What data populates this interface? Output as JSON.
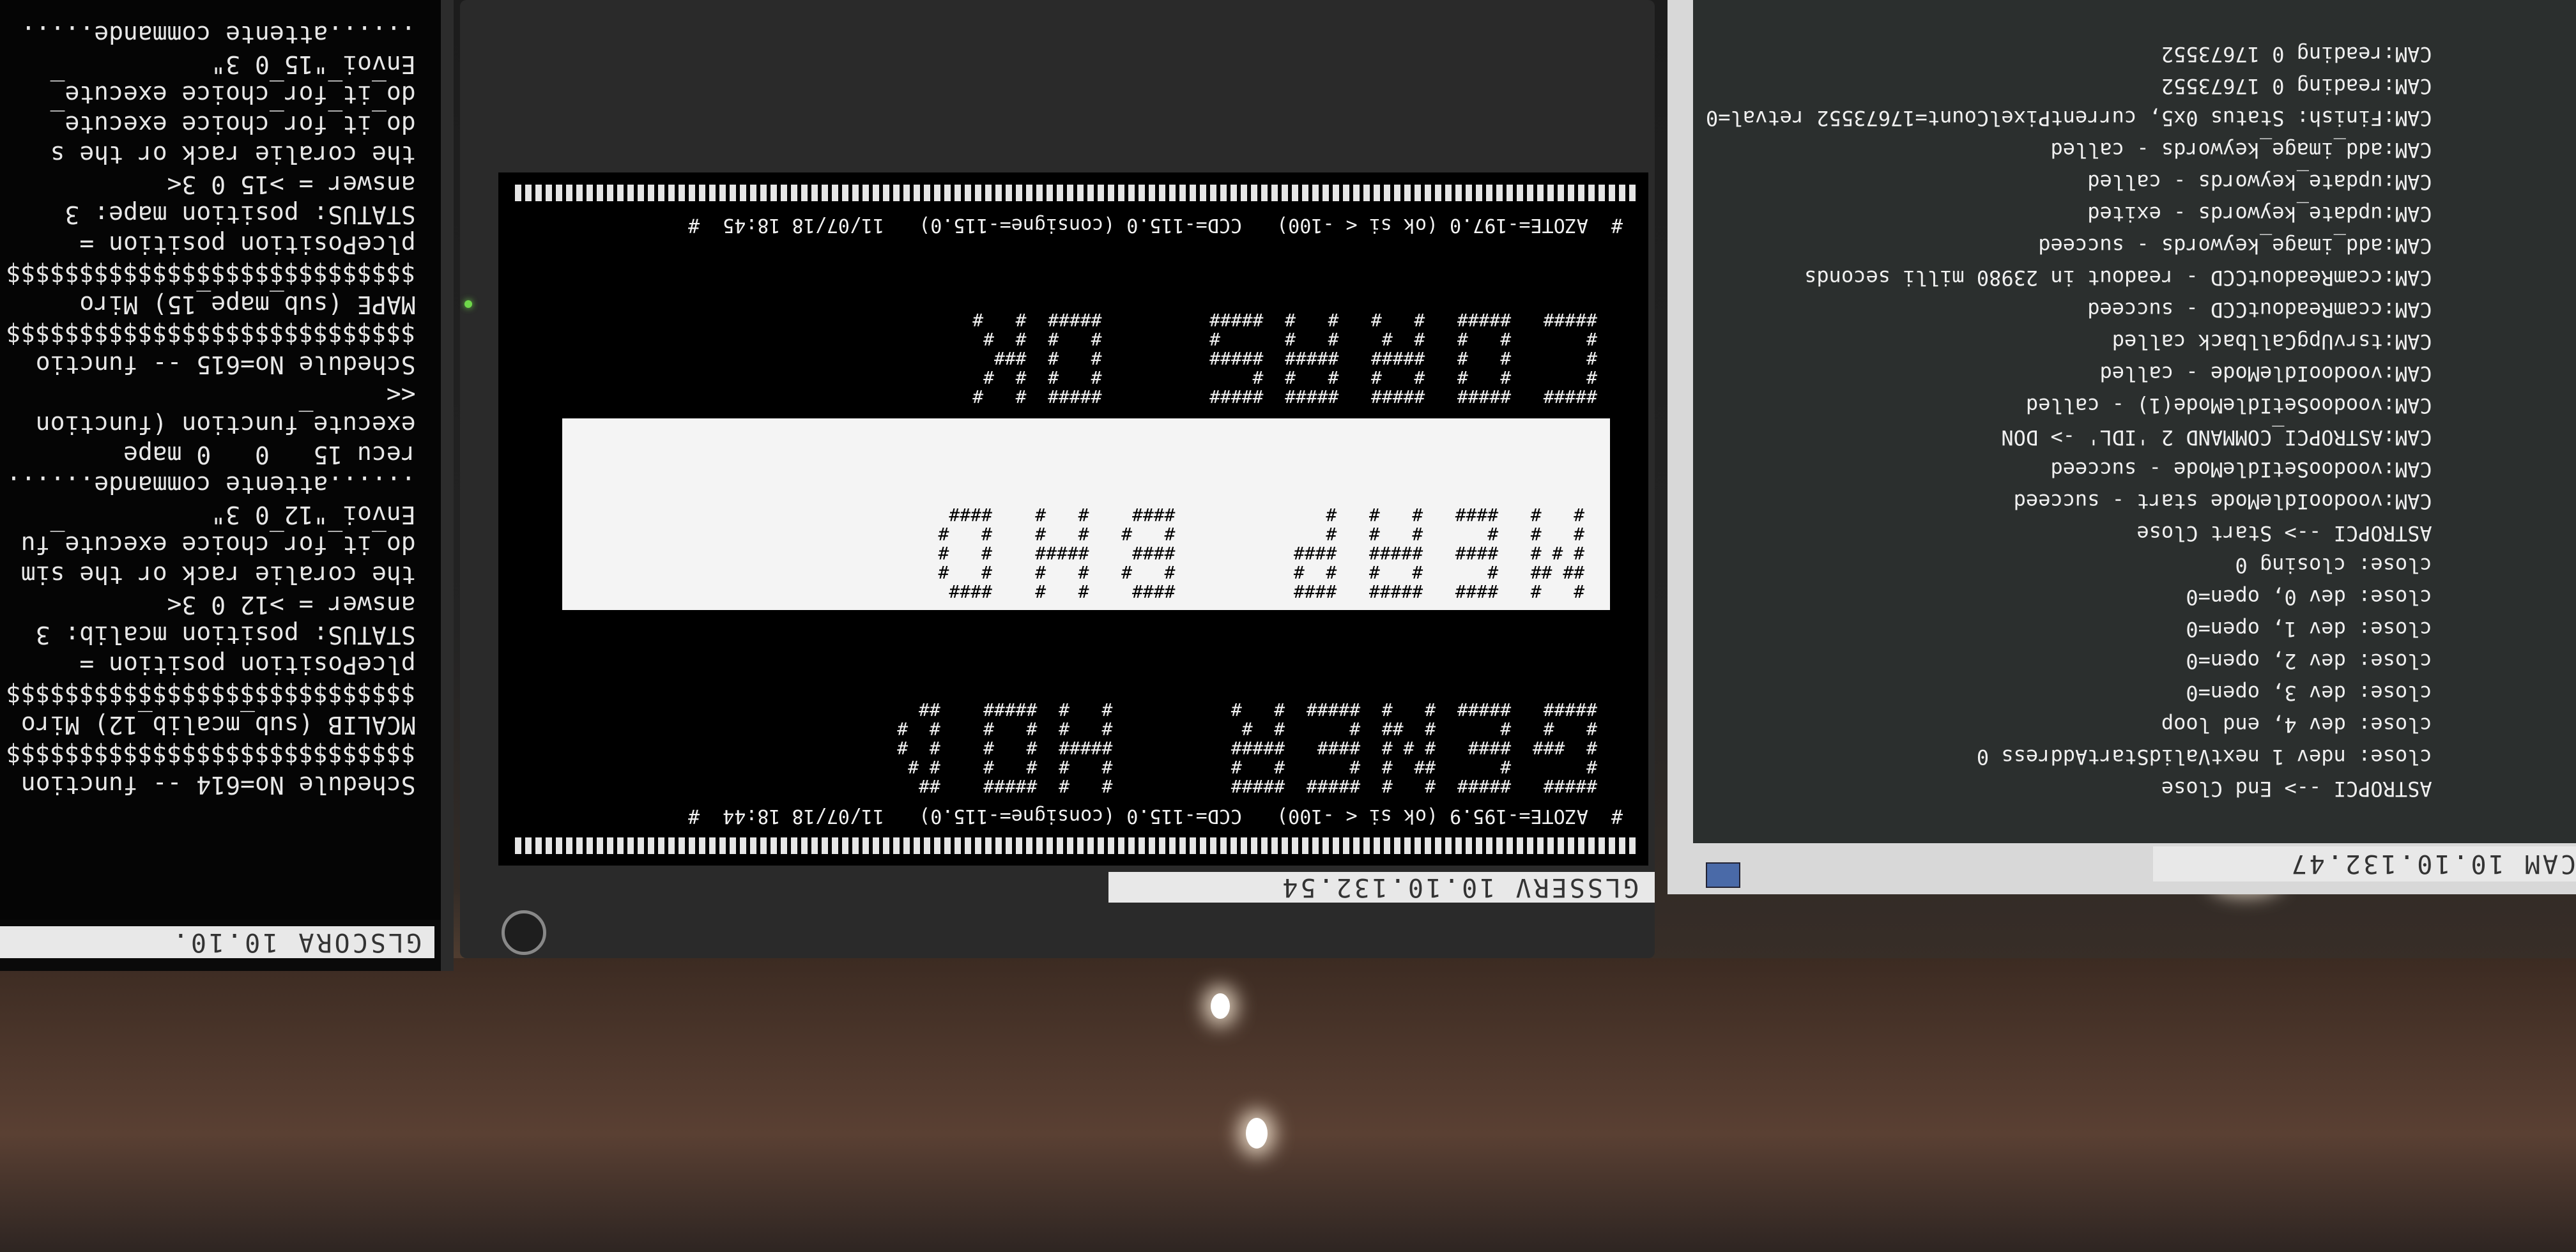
{
  "left_monitor": {
    "label": "GLSCORA  10.10.",
    "terminal_lines": [
      "Schedule No=614 -- function",
      "$$$$$$$$$$$$$$$$$$$$$$$$$$$$",
      "MCALIB (sub_mcalib_12) Miro",
      "$$$$$$$$$$$$$$$$$$$$$$$$$$$$",
      "plcePosition position =",
      "STATUS: position mcalib: 3",
      "answer = >12 0 3<",
      "the coralie rack or the sim",
      "do_it_for_choice execute_fu",
      "Envoi \"12 0 3\"",
      "......attente commande......",
      "recu 15   0   0 mape   ",
      "execute_function (function",
      "<<",
      "Schedule No=615 -- functio",
      "$$$$$$$$$$$$$$$$$$$$$$$$$$$$",
      "MAPE (sub_mape_15) Miro",
      "$$$$$$$$$$$$$$$$$$$$$$$$$$$$",
      "plcePosition position =",
      "STATUS: position mape: 3",
      "answer = >15 0 3<",
      "the coralie rack or the s",
      "do_it_for_choice execute_",
      "do_it_for_choice execute_",
      "Envoi \"15 0 3\"",
      "......attente commande....."
    ]
  },
  "center_monitor": {
    "label": "GLSSERV   10.10.132.54",
    "status_top": "#  AZOTE=-195.9 (ok si < -100)   CCD=-115.0 (consigne=-115.0)   11/07/18 18:44  #",
    "status_bottom": "#  AZOTE=-197.0 (ok si < -100)   CCD=-115.0 (consigne=-115.0)   11/07/18 18:45  #",
    "banner_row1": [
      "#####   #####  #   #  #####  #####           #   #  #####    ##  ",
      "#       #      ##  #  #      #   #           #   #  #   #    # # ",
      "#  ###  ####   # # #  ####   #####           #####  #   #    #  #",
      "#   #   #      #  ##  #      #  #            #   #  #   #    #  #",
      "#####   #####  #   #  #####  #   #           #   #  #####    ##  "
    ],
    "banner_row2_inverse": [
      "#   #   ####   #####   ####           ####    #   #    ####  ",
      "## ##   #      #   #   #  #           #   #   #   #    #   # ",
      "# # #   ####   #####   ####           ####    #####    #   # ",
      "#   #   #      #   #   #              #   #   #   #    #   # ",
      "#   #   ####   #   #   #              ####    #   #    ####  "
    ],
    "banner_row3": [
      "#####   #####   #####   #####  #####          #####  #   #   ",
      "#       #   #   #   #   #   #  #              #   #  #  #    ",
      "#       #   #   #####   #####  #####          #   #  ###     ",
      "#       #   #   #  #    #   #      #          #   #  #  #    ",
      "#####   #####   #   #   #   #  #####          #####  #   #   "
    ]
  },
  "right_monitor": {
    "label": "CAM   10.10.132.47",
    "log_lines": [
      "ASTROPCI --> End Close",
      "close: ndev 1 nextValidStartAddress 0",
      "close: dev 4, end loop",
      "close: dev 3, open=0",
      "close: dev 2, open=0",
      "close: dev 1, open=0",
      "close: dev 0, open=0",
      "close: closing 0",
      "ASTROPCI --> Start Close",
      "CAM:voodooIdleMode start - succeed",
      "CAM:voodooSetIdleMode - succeed",
      "CAM:ASTROPCI_COMMAND 2 'IDL' -> DON",
      "CAM:voodooSetIdleMode(1) - called",
      "CAM:voodooIdleMode - called",
      "CAM:tsrvUpgCallback called",
      "CAM:ccamReadoutCCD - succeed",
      "CAM:ccamReadoutCCD - readout in 23980 milli seconds",
      "CAM:add_image_keywords - succeed",
      "CAM:update_keywords - exited",
      "CAM:update_keywords - called",
      "CAM:add_image_keywords - called",
      "CAM:Finish: Status 0x5, currentPixelCount=17673552 retval=0",
      "CAM:reading 0 17673552",
      "CAM:reading 0 17673552"
    ]
  },
  "colors": {
    "terminal_bg": "#000000",
    "terminal_fg": "#f0f0f0",
    "banner_inverse_bg": "#f4f4f4",
    "right_terminal_bg": "#2b2f2e"
  }
}
